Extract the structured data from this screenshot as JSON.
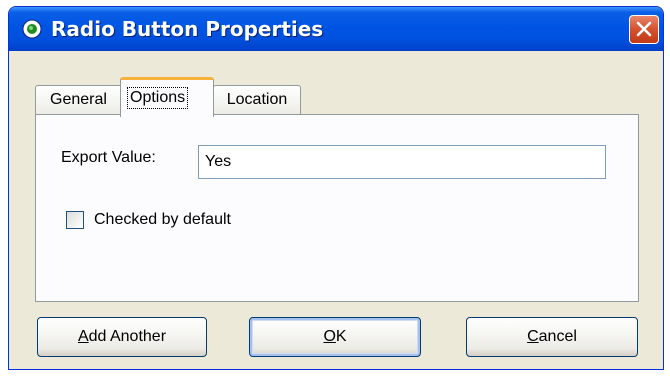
{
  "window": {
    "title": "Radio Button Properties",
    "icon": "radio-button-icon",
    "close_icon": "close-icon"
  },
  "tabs": [
    {
      "label": "General",
      "selected": false
    },
    {
      "label": "Options",
      "selected": true
    },
    {
      "label": "Location",
      "selected": false
    }
  ],
  "options": {
    "export_value_label": "Export Value:",
    "export_value": "Yes",
    "checked_by_default_label": "Checked by default",
    "checked_by_default": false
  },
  "buttons": {
    "add_another": {
      "mnemonic": "A",
      "rest": "dd Another"
    },
    "ok": {
      "mnemonic": "O",
      "rest": "K"
    },
    "cancel": {
      "mnemonic": "C",
      "rest": "ancel"
    }
  },
  "colors": {
    "titlebar": "#0054e3",
    "dialog_bg": "#ece9d8",
    "close_button": "#d4502e",
    "selected_tab_accent": "#f7b23c"
  }
}
